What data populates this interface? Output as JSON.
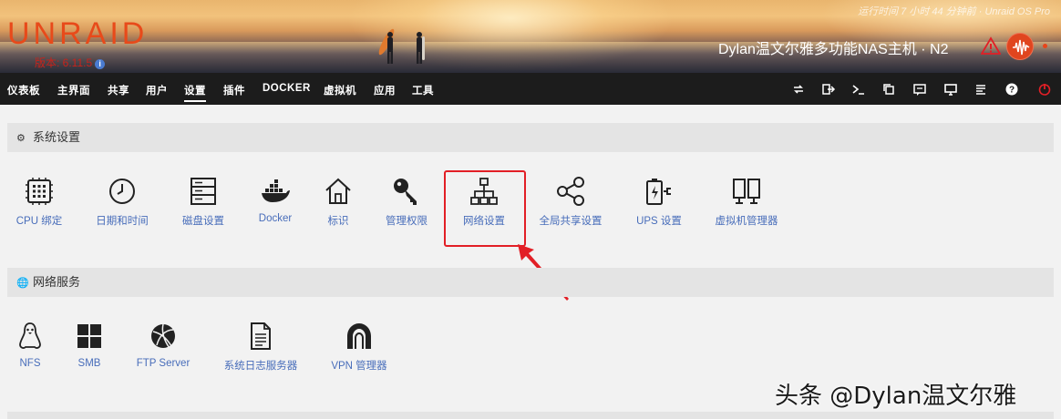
{
  "header": {
    "logo": "UNRAID",
    "version": "版本: 6.11.5",
    "uptime": "运行时间 7 小时 44 分钟前 · Unraid OS Pro",
    "hostname": "Dylan温文尔雅多功能NAS主机 · N2"
  },
  "nav": {
    "items": [
      {
        "label": "仪表板"
      },
      {
        "label": "主界面"
      },
      {
        "label": "共享"
      },
      {
        "label": "用户"
      },
      {
        "label": "设置"
      },
      {
        "label": "插件"
      },
      {
        "label": "DOCKER"
      },
      {
        "label": "虚拟机"
      },
      {
        "label": "应用"
      },
      {
        "label": "工具"
      }
    ],
    "active_index": 4,
    "right_icons": [
      "refresh-icon",
      "logout-icon",
      "terminal-icon",
      "copy-icon",
      "feedback-icon",
      "monitor-icon",
      "log-icon",
      "help-icon",
      "power-icon"
    ]
  },
  "system_settings": {
    "title": "系统设置",
    "icon": "gear-icon",
    "tiles": [
      {
        "label": "CPU 绑定",
        "icon": "cpu-icon"
      },
      {
        "label": "日期和时间",
        "icon": "clock-icon"
      },
      {
        "label": "磁盘设置",
        "icon": "disk-icon"
      },
      {
        "label": "Docker",
        "icon": "docker-icon"
      },
      {
        "label": "标识",
        "icon": "home-icon"
      },
      {
        "label": "管理权限",
        "icon": "key-icon"
      },
      {
        "label": "网络设置",
        "icon": "network-icon"
      },
      {
        "label": "全局共享设置",
        "icon": "share-icon"
      },
      {
        "label": "UPS 设置",
        "icon": "battery-icon"
      },
      {
        "label": "虚拟机管理器",
        "icon": "vm-icon"
      }
    ]
  },
  "network_services": {
    "title": "网络服务",
    "icon": "globe-icon",
    "tiles": [
      {
        "label": "NFS",
        "icon": "linux-icon"
      },
      {
        "label": "SMB",
        "icon": "windows-icon"
      },
      {
        "label": "FTP Server",
        "icon": "ftp-icon"
      },
      {
        "label": "系统日志服务器",
        "icon": "syslog-icon"
      },
      {
        "label": "VPN 管理器",
        "icon": "vpn-icon"
      }
    ]
  },
  "watermark": "头条 @Dylan温文尔雅",
  "colors": {
    "accent": "#e84a1a",
    "link": "#486dba",
    "nav_bg": "#1c1c1c",
    "highlight": "#e21f26"
  }
}
